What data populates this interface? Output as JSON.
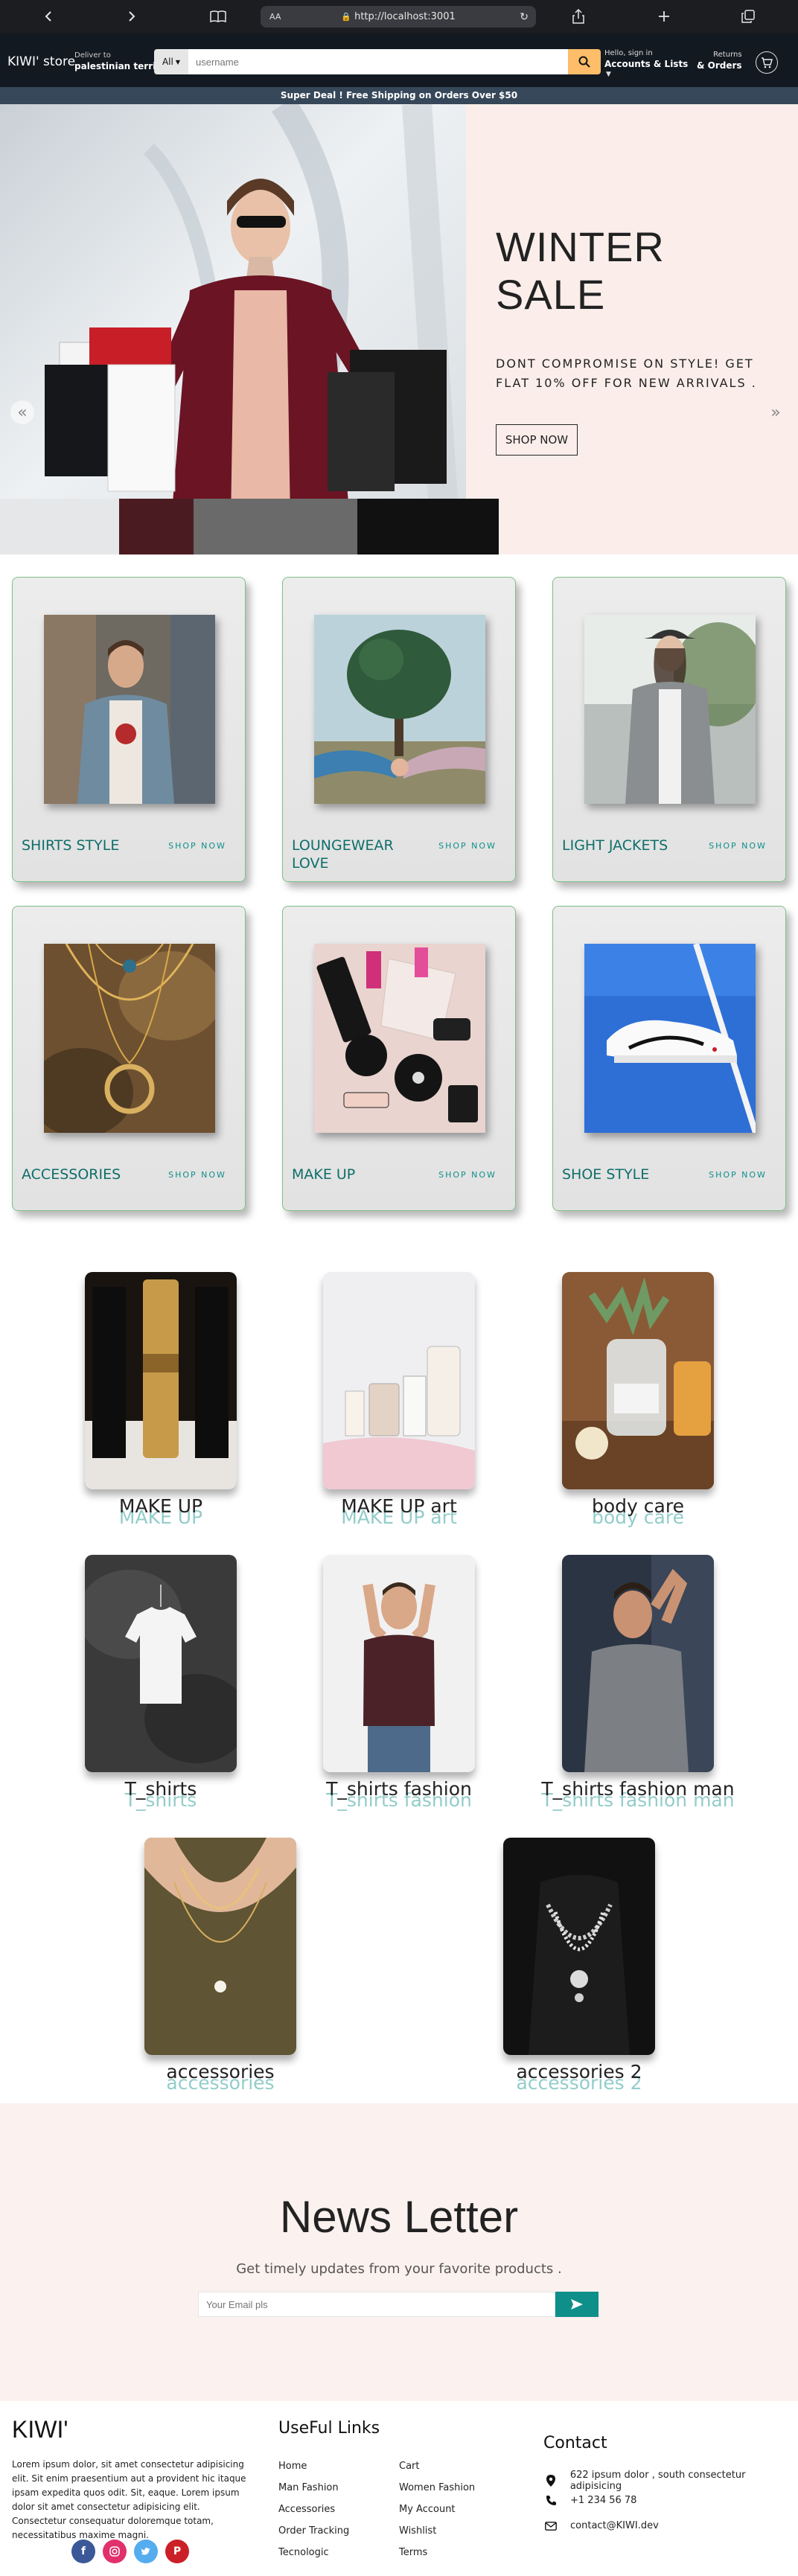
{
  "browser": {
    "text_size_label": "AA",
    "url": "http://localhost:3001",
    "nav_back_icon": "chevron-left-icon",
    "nav_forward_icon": "chevron-right-icon"
  },
  "header": {
    "logo": "KIWI' store",
    "deliver_line1": "Deliver to",
    "deliver_line2": "palestinian terri...",
    "search_category": "All",
    "search_placeholder": "username",
    "account_line1": "Hello, sign in",
    "account_line2": "Accounts & Lists",
    "returns_line1": "Returns",
    "returns_line2": "& Orders"
  },
  "promo_banner": "Super Deal ! Free Shipping on Orders Over $50",
  "hero": {
    "title_line1": "WINTER",
    "title_line2": "SALE",
    "description": "DONT COMPROMISE ON STYLE! GET FLAT 10% OFF FOR NEW ARRIVALS .",
    "button": "SHOP NOW"
  },
  "categories": [
    {
      "name": "SHIRTS STYLE",
      "action": "SHOP NOW"
    },
    {
      "name": "LOUNGEWEAR LOVE",
      "action": "SHOP NOW"
    },
    {
      "name": "LIGHT JACKETS",
      "action": "SHOP NOW"
    },
    {
      "name": "ACCESSORIES",
      "action": "SHOP NOW"
    },
    {
      "name": "MAKE UP",
      "action": "SHOP NOW"
    },
    {
      "name": "SHOE STYLE",
      "action": "SHOP NOW"
    }
  ],
  "products": [
    {
      "title": "MAKE UP"
    },
    {
      "title": "MAKE UP art"
    },
    {
      "title": "body care"
    },
    {
      "title": "T_shirts"
    },
    {
      "title": "T_shirts fashion"
    },
    {
      "title": "T_shirts fashion man"
    },
    {
      "title": "accessories"
    },
    {
      "title": "accessories 2"
    }
  ],
  "newsletter": {
    "title": "News Letter",
    "subtitle": "Get timely updates from your favorite products .",
    "placeholder": "Your Email pls"
  },
  "footer": {
    "logo": "KIWI'",
    "about": "Lorem ipsum dolor, sit amet consectetur adipisicing elit. Sit enim praesentium aut a provident hic itaque ipsam expedita quos odit. Sit, eaque. Lorem ipsum dolor sit amet consectetur adipisicing elit. Consectetur consequatur doloremque totam, necessitatibus maxime magni.",
    "links_title": "UseFul Links",
    "links_col1": [
      "Home",
      "Man Fashion",
      "Accessories",
      "Order Tracking",
      "Tecnologic"
    ],
    "links_col2": [
      "Cart",
      "Women Fashion",
      "My Account",
      "Wishlist",
      "Terms"
    ],
    "contact_title": "Contact",
    "address": "622 ipsum dolor , south consectetur adipisicing",
    "phone": "+1 234 56 78",
    "email": "contact@KIWI.dev"
  },
  "colors": {
    "header_bg": "#131921",
    "promo_bg": "#37475a",
    "search_button": "#febd69",
    "accent_teal": "#0e8f8a",
    "hero_bg": "#fbeeea",
    "newsletter_bg": "#fbf1ef"
  }
}
